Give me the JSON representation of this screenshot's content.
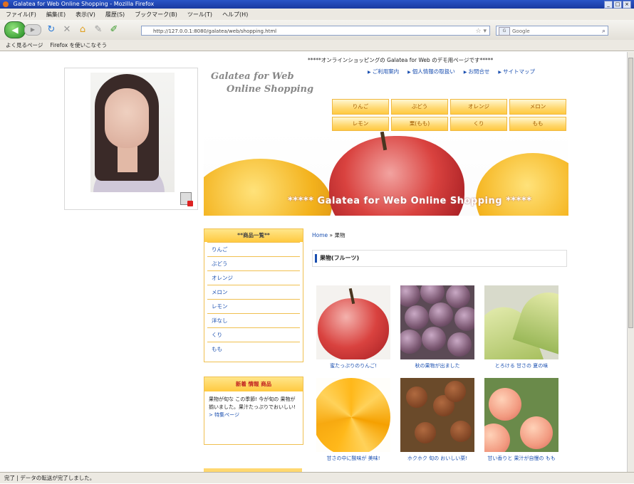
{
  "window": {
    "title": "Galatea for Web Online Shopping - Mozilla Firefox"
  },
  "menu": [
    "ファイル(F)",
    "編集(E)",
    "表示(V)",
    "履歴(S)",
    "ブックマーク(B)",
    "ツール(T)",
    "ヘルプ(H)"
  ],
  "toolbar": {
    "url": "http://127.0.0.1:8080/galatea/web/shopping.html",
    "search_engine": "G",
    "search_placeholder": "Google"
  },
  "bookmarks": [
    "よく見るページ",
    "Firefox を使いこなそう"
  ],
  "page": {
    "marquee": "*****オンラインショッピングの Galatea for Web のデモ用ページです*****",
    "top_links": [
      "ご利用案内",
      "個人情報の取扱い",
      "お問合せ",
      "サイトマップ"
    ],
    "logo_line1": "Galatea for Web",
    "logo_line2": "Online Shopping",
    "fruit_nav": [
      "りんご",
      "ぶどう",
      "オレンジ",
      "メロン",
      "レモン",
      "栗(もも)",
      "くり",
      "もも"
    ],
    "banner_text": "***** Galatea for Web Online Shopping *****",
    "sidebar": {
      "title": "**商品一覧**",
      "items": [
        "りんご",
        "ぶどう",
        "オレンジ",
        "メロン",
        "レモン",
        "洋なし",
        "くり",
        "もも"
      ],
      "news_title": "新着 情報 商品",
      "news_text": "果物が旬な この季節! 今が旬の 果物が揃いました。果汁たっぷりでおいしい!",
      "news_link": "> 特集ページ"
    },
    "breadcrumb_home": "Home",
    "breadcrumb_current": "果物",
    "category_title": "果物(フルーツ)",
    "products": [
      {
        "caption": "蜜たっぷりのりんご!"
      },
      {
        "caption": "秋の果物が出ました"
      },
      {
        "caption": "とろける 甘さの 夏の味"
      },
      {
        "caption": "甘さの中に酸味が 美味!"
      },
      {
        "caption": "ホクホク 旬の おいしい栗!"
      },
      {
        "caption": "甘い香りと 果汁が自慢の もも"
      }
    ]
  },
  "status": "完了 | データの転送が完了しました。"
}
